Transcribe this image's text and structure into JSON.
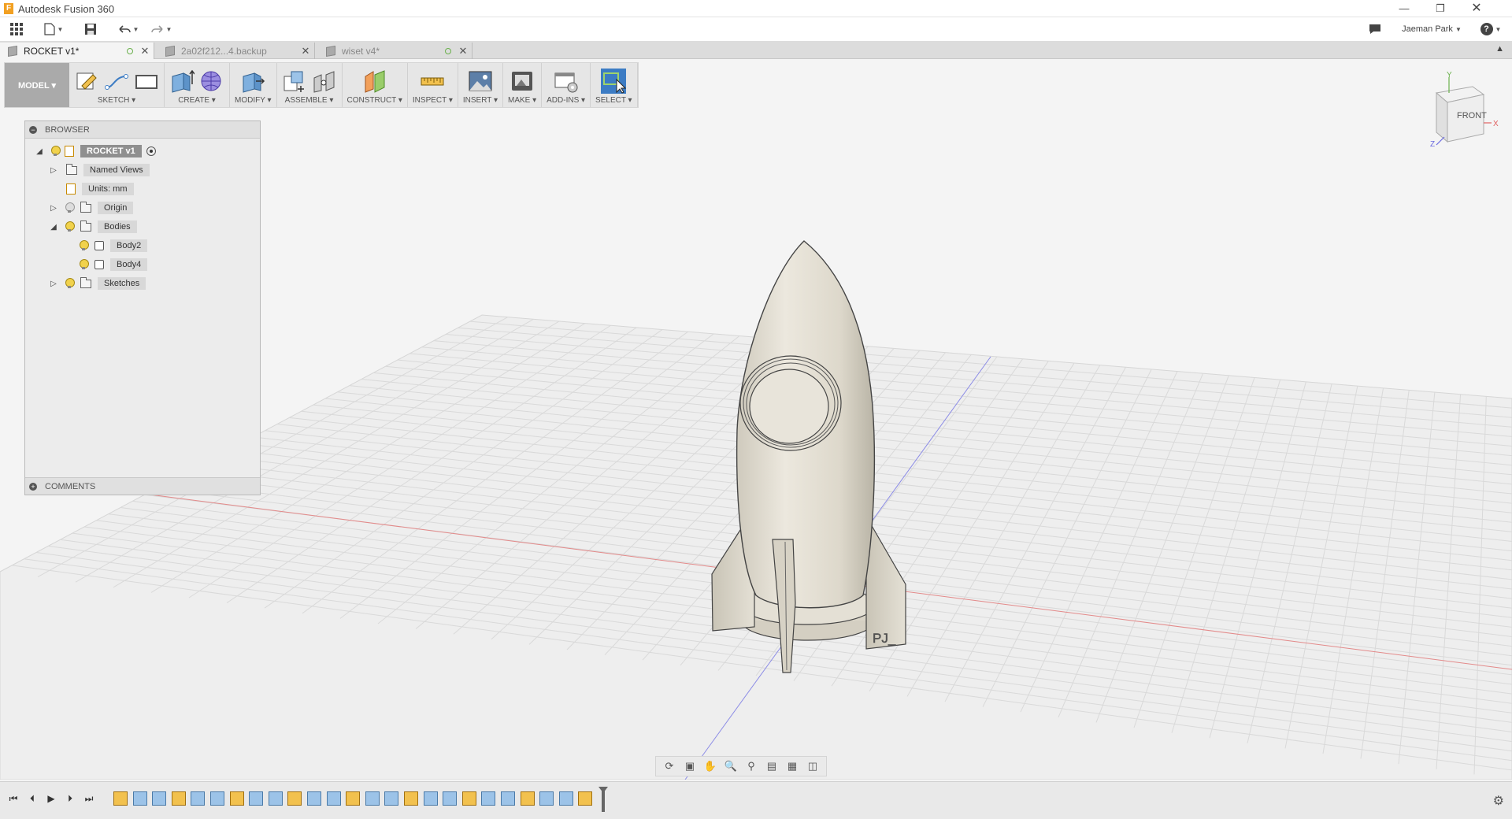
{
  "window": {
    "title": "Autodesk Fusion 360",
    "app_icon_letter": "F"
  },
  "quick_access": {
    "user_name": "Jaeman Park",
    "help_label": "?"
  },
  "tabs": [
    {
      "label": "ROCKET v1*",
      "active": true
    },
    {
      "label": "2a02f212...4.backup",
      "active": false
    },
    {
      "label": "wiset v4*",
      "active": false
    }
  ],
  "toolbar": {
    "workspace": "MODEL ▾",
    "groups": [
      {
        "label": "SKETCH ▾"
      },
      {
        "label": "CREATE ▾"
      },
      {
        "label": "MODIFY ▾"
      },
      {
        "label": "ASSEMBLE ▾"
      },
      {
        "label": "CONSTRUCT ▾"
      },
      {
        "label": "INSPECT ▾"
      },
      {
        "label": "INSERT ▾"
      },
      {
        "label": "MAKE ▾"
      },
      {
        "label": "ADD-INS ▾"
      },
      {
        "label": "SELECT ▾"
      }
    ]
  },
  "browser": {
    "title": "BROWSER",
    "root": "ROCKET v1",
    "nodes": [
      {
        "label": "Named Views"
      },
      {
        "label": "Units: mm"
      },
      {
        "label": "Origin"
      },
      {
        "label": "Bodies"
      },
      {
        "label": "Body2"
      },
      {
        "label": "Body4"
      },
      {
        "label": "Sketches"
      }
    ],
    "comments_label": "COMMENTS"
  },
  "viewcube": {
    "face": "FRONT",
    "axes": [
      "Y",
      "X",
      "Z"
    ]
  },
  "model": {
    "engraving": "PJ_"
  },
  "colors": {
    "accent": "#3c7cc4",
    "model_body": "#dedad0",
    "grid_bg": "#f4f4f4",
    "x_axis": "#e06060",
    "z_axis": "#6a6ae0"
  }
}
